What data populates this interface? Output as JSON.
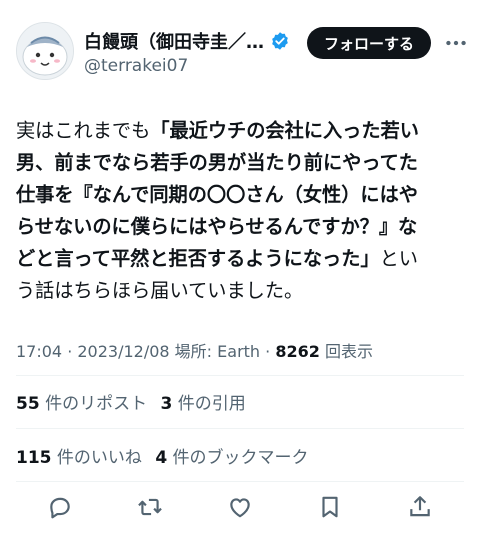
{
  "user": {
    "display_name": "白饅頭（御田寺圭／…",
    "handle": "@terrakei07",
    "follow_label": "フォローする"
  },
  "tweet": {
    "segments": [
      {
        "text": "実はこれまでも",
        "bold": false
      },
      {
        "text": "「最近ウチの会社に入った若い男、前までなら若手の男が当たり前にやってた仕事を『なんで同期の〇〇さん（女性）にはやらせないのに僕らにはやらせるんですか？』などと言って平然と拒否するようになった」",
        "bold": true
      },
      {
        "text": "という話はちらほら届いていました。",
        "bold": false
      }
    ],
    "lines": [
      [
        {
          "t": "実はこれまでも",
          "b": false
        },
        {
          "t": "「最近ウチの会社に入った若い",
          "b": true
        }
      ],
      [
        {
          "t": "男、前までなら若手の男が当たり前にやってた",
          "b": true
        }
      ],
      [
        {
          "t": "仕事を『なんで同期の〇〇さん（女性）にはや",
          "b": true
        }
      ],
      [
        {
          "t": "らせないのに僕らにはやらせるんですか？』な",
          "b": true
        }
      ],
      [
        {
          "t": "どと言って平然と拒否するようになった」",
          "b": true
        },
        {
          "t": "とい",
          "b": false
        }
      ],
      [
        {
          "t": "う話はちらほら届いていました。",
          "b": false
        }
      ]
    ]
  },
  "meta": {
    "time": "17:04",
    "sep1": " · ",
    "date": "2023/12/08",
    "location_label": " 場所: Earth",
    "sep2": " · ",
    "views": "8262",
    "views_label": " 回表示"
  },
  "stats": {
    "reposts": "55",
    "reposts_label": " 件のリポスト",
    "quotes": "3",
    "quotes_label": " 件の引用",
    "likes": "115",
    "likes_label": " 件のいいね",
    "bookmarks": "4",
    "bookmarks_label": " 件のブックマーク"
  },
  "actions": [
    "reply-icon",
    "retweet-icon",
    "like-icon",
    "bookmark-icon",
    "share-icon"
  ],
  "colors": {
    "text": "#0f1419",
    "secondary": "#536471",
    "verified": "#1d9bf0",
    "divider": "#eff3f4"
  }
}
